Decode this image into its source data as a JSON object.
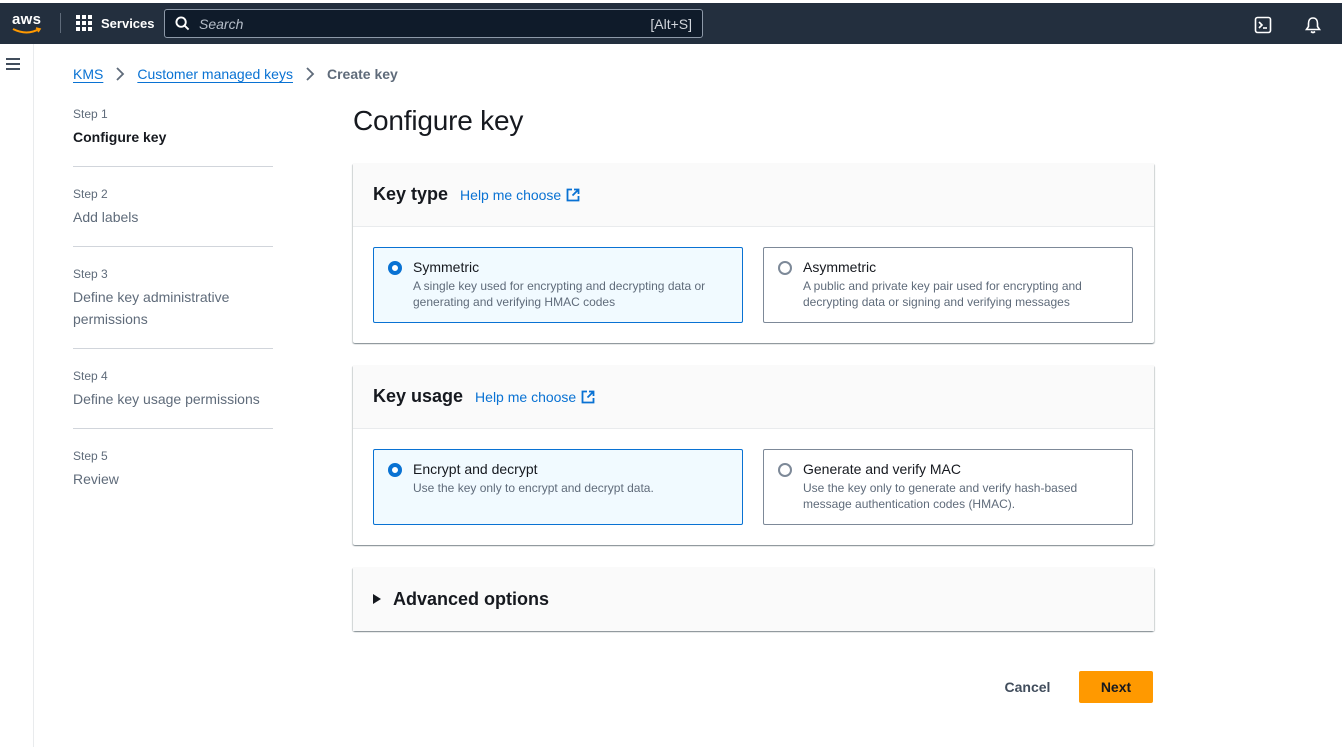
{
  "topnav": {
    "logo_text": "aws",
    "services_label": "Services",
    "search_placeholder": "Search",
    "search_shortcut": "[Alt+S]"
  },
  "breadcrumb": {
    "items": [
      "KMS",
      "Customer managed keys"
    ],
    "current": "Create key"
  },
  "steps": [
    {
      "num": "Step 1",
      "title": "Configure key"
    },
    {
      "num": "Step 2",
      "title": "Add labels"
    },
    {
      "num": "Step 3",
      "title": "Define key administrative permissions"
    },
    {
      "num": "Step 4",
      "title": "Define key usage permissions"
    },
    {
      "num": "Step 5",
      "title": "Review"
    }
  ],
  "page_title": "Configure key",
  "key_type": {
    "title": "Key type",
    "help": "Help me choose",
    "options": [
      {
        "label": "Symmetric",
        "desc": "A single key used for encrypting and decrypting data or generating and verifying HMAC codes",
        "selected": true
      },
      {
        "label": "Asymmetric",
        "desc": "A public and private key pair used for encrypting and decrypting data or signing and verifying messages",
        "selected": false
      }
    ]
  },
  "key_usage": {
    "title": "Key usage",
    "help": "Help me choose",
    "options": [
      {
        "label": "Encrypt and decrypt",
        "desc": "Use the key only to encrypt and decrypt data.",
        "selected": true
      },
      {
        "label": "Generate and verify MAC",
        "desc": "Use the key only to generate and verify hash-based message authentication codes (HMAC).",
        "selected": false
      }
    ]
  },
  "advanced": {
    "title": "Advanced options"
  },
  "actions": {
    "cancel": "Cancel",
    "next": "Next"
  },
  "colors": {
    "nav": "#232f3e",
    "link": "#0972d3",
    "primary": "#ff9900",
    "selected_bg": "#f1faff"
  }
}
